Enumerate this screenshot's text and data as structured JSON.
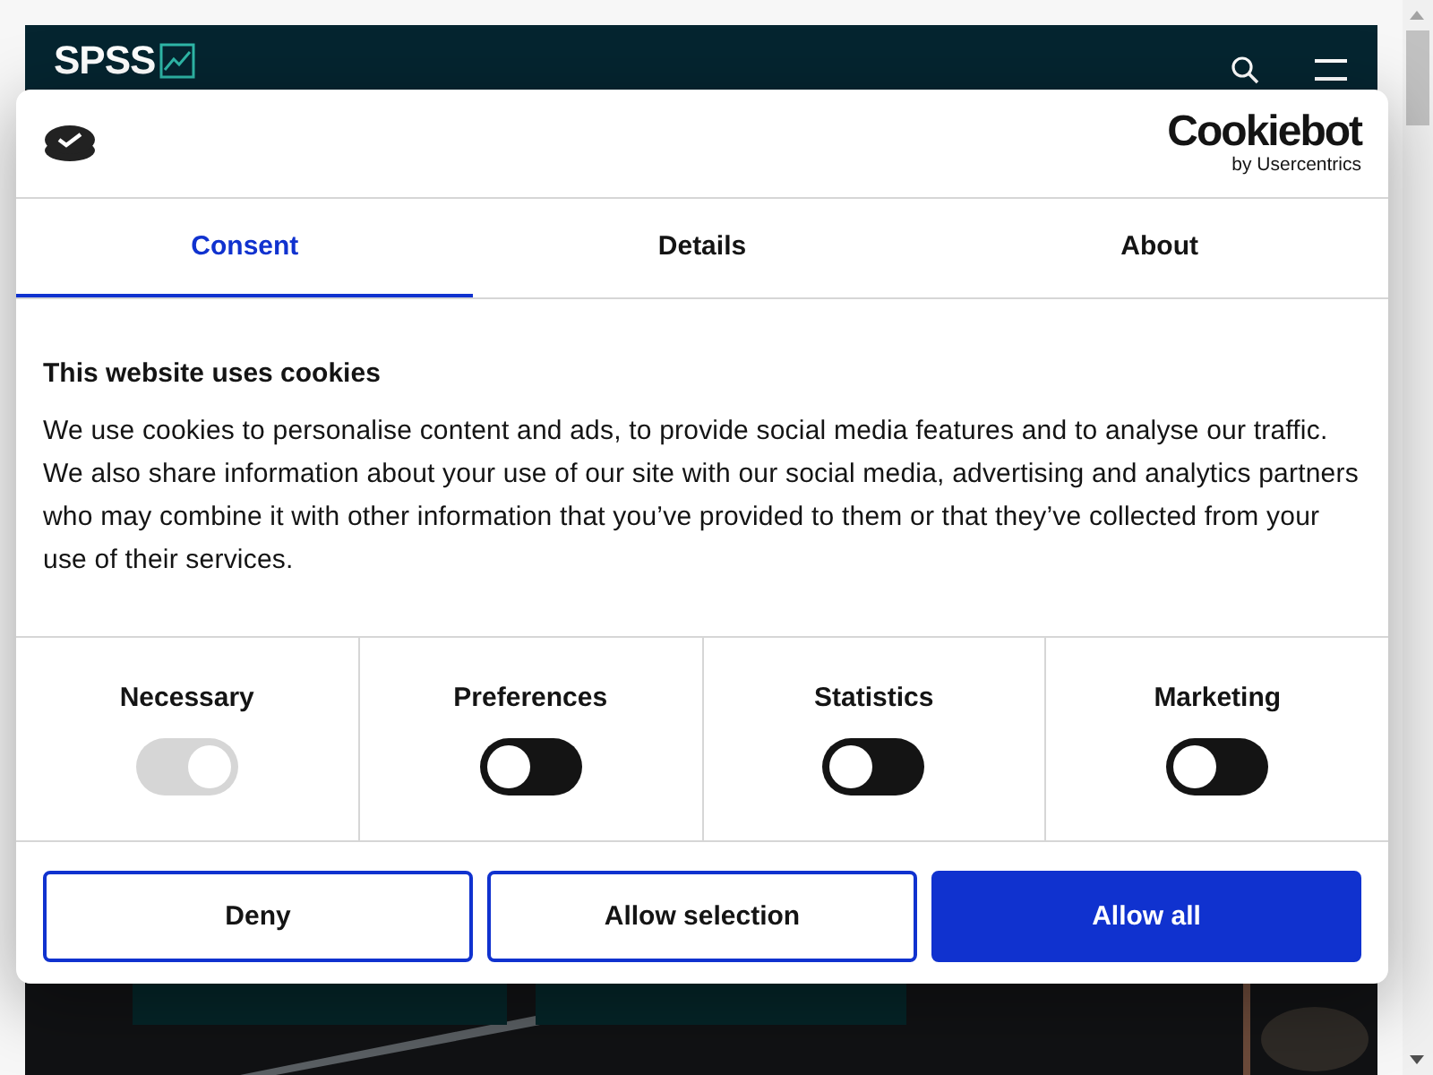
{
  "site_header": {
    "logo": "SPSS"
  },
  "dialog": {
    "brand": "Cookiebot",
    "brand_sub": "by Usercentrics",
    "tabs": [
      {
        "label": "Consent",
        "selected": true
      },
      {
        "label": "Details",
        "selected": false
      },
      {
        "label": "About",
        "selected": false
      }
    ],
    "heading": "This website uses cookies",
    "body": "We use cookies to personalise content and ads, to provide social media features and to analyse our traffic. We also share information about your use of our site with our social media, advertising and analytics partners who may combine it with other information that you’ve provided to them or that they’ve collected from your use of their services.",
    "categories": [
      {
        "label": "Necessary",
        "checked": true,
        "disabled": true
      },
      {
        "label": "Preferences",
        "checked": false,
        "disabled": false
      },
      {
        "label": "Statistics",
        "checked": false,
        "disabled": false
      },
      {
        "label": "Marketing",
        "checked": false,
        "disabled": false
      }
    ],
    "buttons": [
      {
        "label": "Deny",
        "kind": "outline"
      },
      {
        "label": "Allow selection",
        "kind": "outline"
      },
      {
        "label": "Allow all",
        "kind": "primary"
      }
    ]
  }
}
